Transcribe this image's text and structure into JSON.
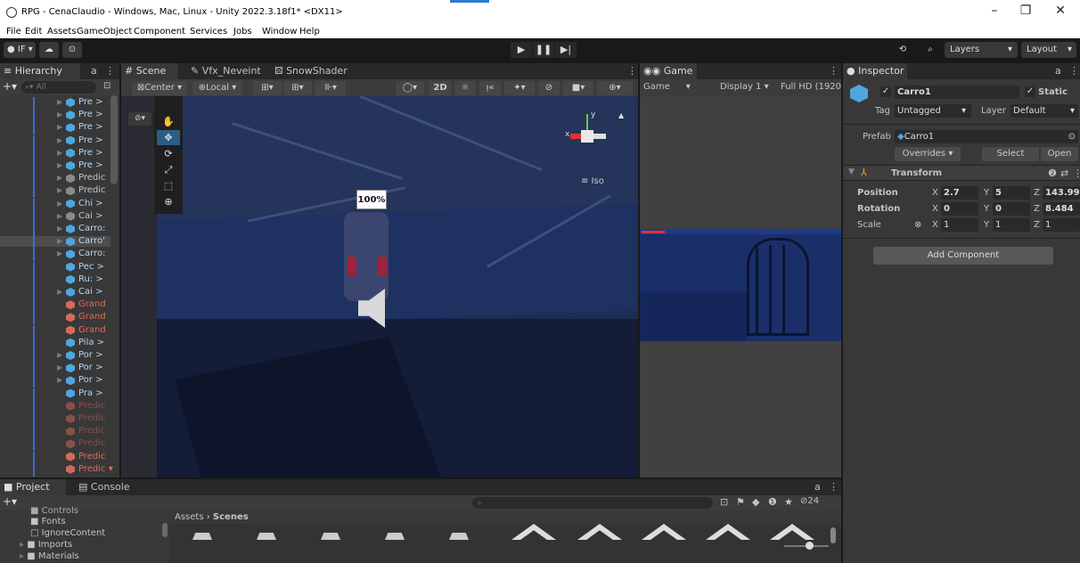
{
  "window": {
    "title": "RPG - CenaClaudio - Windows, Mac, Linux - Unity 2022.3.18f1* <DX11>",
    "minimize": "–",
    "maximize": "❐",
    "close": "✕"
  },
  "menu": [
    "File",
    "Edit",
    "Assets",
    "GameObject",
    "Component",
    "Services",
    "Jobs",
    "Window",
    "Help"
  ],
  "toolbar": {
    "account": "IF ▾",
    "layers": "Layers",
    "layout": "Layout"
  },
  "hierarchy": {
    "tab": "Hierarchy",
    "search_placeholder": "All",
    "rows": [
      {
        "label": "Pre >",
        "icon": "blue",
        "arrow": true
      },
      {
        "label": "Pre >",
        "icon": "blue",
        "arrow": true
      },
      {
        "label": "Pre >",
        "icon": "blue",
        "arrow": true
      },
      {
        "label": "Pre >",
        "icon": "blue",
        "arrow": true
      },
      {
        "label": "Pre >",
        "icon": "blue",
        "arrow": true
      },
      {
        "label": "Pre >",
        "icon": "blue",
        "arrow": true
      },
      {
        "label": "Predic",
        "icon": "grey",
        "arrow": true
      },
      {
        "label": "Predic",
        "icon": "grey",
        "arrow": true
      },
      {
        "label": "Chi >",
        "icon": "blue",
        "arrow": true
      },
      {
        "label": "Cai >",
        "icon": "grey",
        "arrow": true
      },
      {
        "label": "Carro:",
        "icon": "blue",
        "arrow": true
      },
      {
        "label": "Carro'",
        "icon": "blue",
        "arrow": true,
        "selected": true
      },
      {
        "label": "Carro:",
        "icon": "blue",
        "arrow": true
      },
      {
        "label": "Pec >",
        "icon": "blue",
        "arrow": false
      },
      {
        "label": "Ru: >",
        "icon": "blue",
        "arrow": false
      },
      {
        "label": "Cai >",
        "icon": "blue",
        "arrow": true
      },
      {
        "label": "Grand",
        "icon": "red",
        "arrow": false,
        "red": true
      },
      {
        "label": "Grand",
        "icon": "red",
        "arrow": false,
        "red": true
      },
      {
        "label": "Grand",
        "icon": "red",
        "arrow": false,
        "red": true
      },
      {
        "label": "Pila >",
        "icon": "blue",
        "arrow": false
      },
      {
        "label": "Por >",
        "icon": "blue",
        "arrow": true
      },
      {
        "label": "Por >",
        "icon": "blue",
        "arrow": true
      },
      {
        "label": "Por >",
        "icon": "blue",
        "arrow": true
      },
      {
        "label": "Pra >",
        "icon": "blue",
        "arrow": false
      },
      {
        "label": "Predic",
        "icon": "red",
        "arrow": false,
        "faded": true
      },
      {
        "label": "Predic",
        "icon": "red",
        "arrow": false,
        "faded": true
      },
      {
        "label": "Predic",
        "icon": "red",
        "arrow": false,
        "faded": true
      },
      {
        "label": "Predic",
        "icon": "red",
        "arrow": false,
        "faded": true
      },
      {
        "label": "Predic",
        "icon": "red",
        "arrow": false,
        "red": true
      },
      {
        "label": "Predic ▾",
        "icon": "red",
        "arrow": false,
        "red": true
      }
    ]
  },
  "scene": {
    "tabs": [
      "Scene",
      "Vfx_Neveint",
      "SnowShader"
    ],
    "pivot": "Center",
    "space": "Local",
    "mode_2d": "2D",
    "iso_label": "≡ Iso",
    "gizmo_y": "y",
    "gizmo_x": "x",
    "overlay_label": "100%"
  },
  "game": {
    "tab": "Game",
    "mode": "Game",
    "display": "Display 1",
    "resolution": "Full HD (1920"
  },
  "inspector": {
    "tab": "Inspector",
    "object_name": "Carro1",
    "static_label": "Static",
    "tag_label": "Tag",
    "tag_value": "Untagged",
    "layer_label": "Layer",
    "layer_value": "Default",
    "prefab_label": "Prefab",
    "prefab_value": "Carro1",
    "overrides": "Overrides",
    "select": "Select",
    "open": "Open",
    "transform": "Transform",
    "position_label": "Position",
    "rotation_label": "Rotation",
    "scale_label": "Scale",
    "position": {
      "x": "2.7",
      "y": "5",
      "z": "143.99"
    },
    "rotation": {
      "x": "0",
      "y": "0",
      "z": "8.484"
    },
    "scale": {
      "x": "1",
      "y": "1",
      "z": "1"
    },
    "add_component": "Add Component"
  },
  "project": {
    "tabs": [
      "Project",
      "Console"
    ],
    "breadcrumb_root": "Assets",
    "breadcrumb_leaf": "Scenes",
    "folders": [
      "Controls",
      "Fonts",
      "IgnoreContent",
      "Imports",
      "Materials"
    ],
    "hidden_count": "24"
  },
  "colors": {
    "accent_blue": "#4ea6e0",
    "selection": "#2c5d87",
    "prefab_red": "#d36a5a",
    "panel": "#383838",
    "scene_bg": "#1d2c52"
  }
}
